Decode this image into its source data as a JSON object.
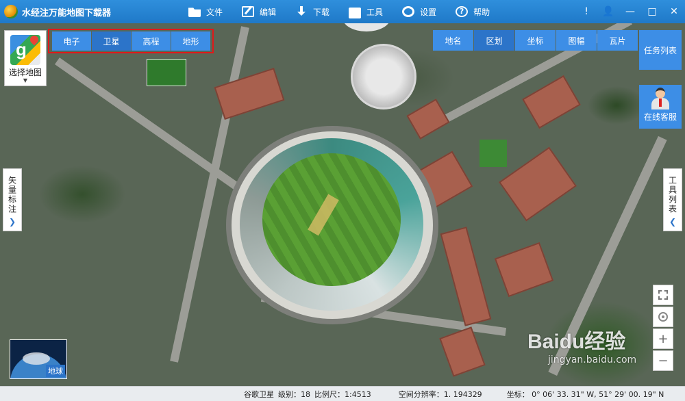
{
  "app": {
    "title": "水经注万能地图下载器"
  },
  "menu": {
    "items": [
      {
        "label": "文件",
        "icon": "folder-icon"
      },
      {
        "label": "编辑",
        "icon": "edit-icon"
      },
      {
        "label": "下载",
        "icon": "download-icon"
      },
      {
        "label": "工具",
        "icon": "toolbox-icon"
      },
      {
        "label": "设置",
        "icon": "gear-icon"
      },
      {
        "label": "帮助",
        "icon": "help-icon"
      }
    ]
  },
  "window_controls": {
    "info": "!",
    "user": "👤",
    "minimize": "—",
    "maximize": "□",
    "close": "✕"
  },
  "map_selector": {
    "label": "选择地图",
    "arrow": "▼"
  },
  "map_types": {
    "tabs": [
      "电子",
      "卫星",
      "高程",
      "地形"
    ],
    "active_index": 1
  },
  "overlays": {
    "tabs": [
      "地名",
      "区划",
      "坐标",
      "图幅",
      "瓦片"
    ],
    "active_index": 1
  },
  "right_panel": {
    "task_list": "任务列表",
    "online_service": "在线客服"
  },
  "side_drawers": {
    "left_label": "矢量标注",
    "left_arrow": "❯",
    "right_label": "工具列表",
    "right_arrow": "❮"
  },
  "zoom": {
    "zoom_in": "+",
    "zoom_out": "−"
  },
  "earth_thumb": {
    "label": "地球"
  },
  "watermark": {
    "logo": "Baidu经验",
    "sub": "jingyan.baidu.com"
  },
  "status": {
    "source": "谷歌卫星",
    "level": "级别：18",
    "scale": "比例尺：1:4513",
    "resolution": "空间分辨率：1. 194329",
    "coords": "坐标：   0° 06' 33. 31\" W, 51° 29' 00. 19\" N"
  },
  "colors": {
    "titlebar": "#2186d4",
    "tab_blue": "#3d8ee6",
    "highlight_border": "#e01919"
  }
}
